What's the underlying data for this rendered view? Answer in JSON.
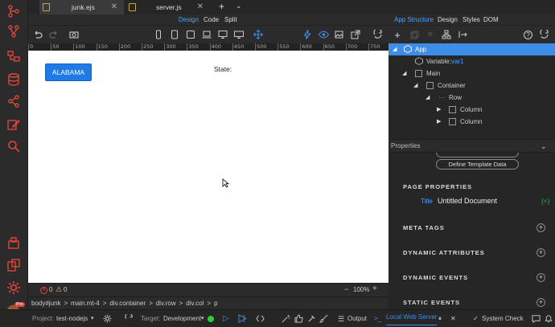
{
  "tabs": [
    {
      "label": "junk.ejs",
      "active": true
    },
    {
      "label": "server.js",
      "active": false
    }
  ],
  "tab_add": "+",
  "tab_menu": "⌄",
  "modes": {
    "design": "Design",
    "code": "Code",
    "split": "Split"
  },
  "right_modes": {
    "app_structure": "App Structure",
    "design": "Design",
    "styles": "Styles",
    "dom": "DOM"
  },
  "ruler_ticks": [
    "0",
    "50",
    "100",
    "150",
    "200",
    "250",
    "300",
    "350",
    "400",
    "450",
    "500",
    "550",
    "600",
    "650",
    "700",
    "750"
  ],
  "canvas": {
    "button_label": "ALABAMA",
    "state_label": "State:"
  },
  "status": {
    "errors": "0",
    "warnings": "0",
    "zoom": "100%",
    "minus": "−",
    "plus": "+"
  },
  "breadcrumb": [
    {
      "tag": "body",
      "cls": "#junk"
    },
    {
      "tag": "main",
      "cls": ".mt-4"
    },
    {
      "tag": "div",
      "cls": ".container"
    },
    {
      "tag": "div",
      "cls": ".row"
    },
    {
      "tag": "div",
      "cls": ".col"
    },
    {
      "tag": "p",
      "cls": ""
    }
  ],
  "tree": {
    "app": "App",
    "variable_prefix": "Variable:",
    "variable_name": "var1",
    "main": "Main",
    "container": "Container",
    "row": "Row",
    "column1": "Column",
    "column2": "Column"
  },
  "properties": {
    "header": "Properties",
    "define_template": "Define Template Data",
    "page_properties": "PAGE PROPERTIES",
    "title_label": "Title",
    "title_value": "Untitled Document",
    "title_badge": "{⚡}",
    "meta_tags": "META TAGS",
    "dynamic_attributes": "DYNAMIC ATTRIBUTES",
    "dynamic_events": "DYNAMIC EVENTS",
    "static_events": "STATIC EVENTS"
  },
  "bottom": {
    "project_label": "Project:",
    "project_value": "test-nodejs",
    "target_label": "Target:",
    "target_value": "Development",
    "output": "Output",
    "local_server": "Local Web Server",
    "system_check": "System Check",
    "avatar_badge": "Pro"
  },
  "colors": {
    "accent": "#1f7ae6",
    "tree_selected": "#3d8ee8",
    "class_yellow": "#e9c95f",
    "green": "#2ecc40"
  }
}
